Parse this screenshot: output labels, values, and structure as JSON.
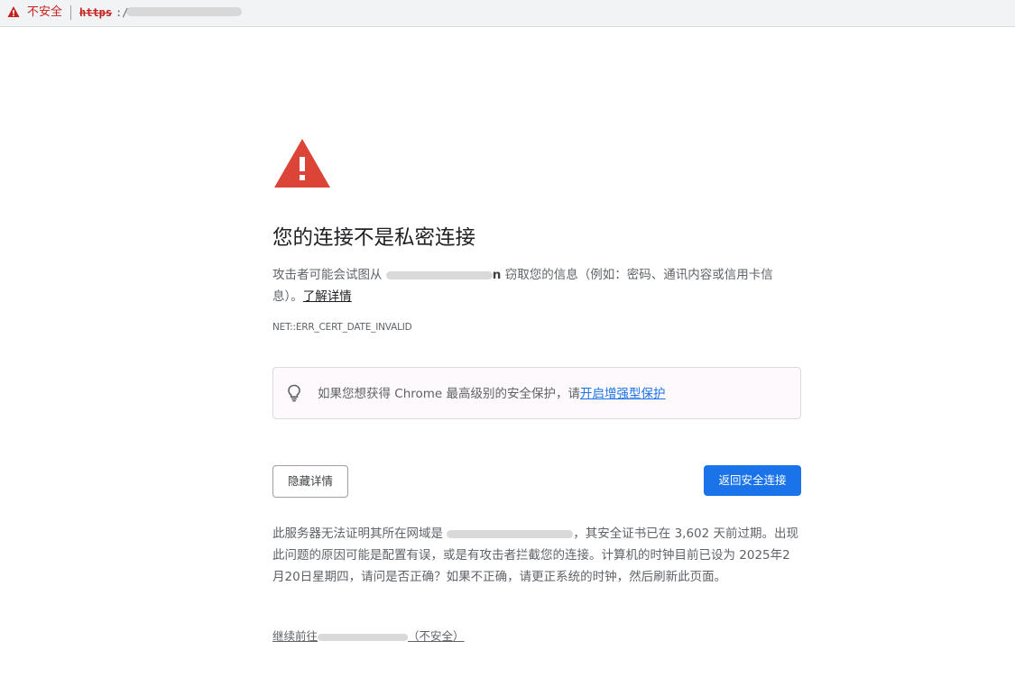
{
  "address_bar": {
    "security_label": "不安全",
    "url_scheme": "https",
    "url_rest": ":/"
  },
  "interstitial": {
    "title": "您的连接不是私密连接",
    "desc_before_host": "攻击者可能会试图从 ",
    "desc_host_fragment": "n",
    "desc_after_host": " 窃取您的信息（例如：密码、通讯内容或信用卡信息）。",
    "learn_more": "了解详情",
    "error_code": "NET::ERR_CERT_DATE_INVALID",
    "promo_text": "如果您想获得 Chrome 最高级别的安全保护，请",
    "promo_link": "开启增强型保护",
    "hide_details_button": "隐藏详情",
    "back_button": "返回安全连接",
    "details_before_host": "此服务器无法证明其所在网域是 ",
    "details_after_host": "，其安全证书已在 3,602 天前过期。出现此问题的原因可能是配置有误，或是有攻击者拦截您的连接。计算机的时钟目前已设为 2025年2月20日星期四，请问是否正确？如果不正确，请更正系统的时钟，然后刷新此页面。",
    "proceed_prefix": "继续前往",
    "proceed_suffix": "（不安全）"
  },
  "colors": {
    "warning_red": "#db4437",
    "link_blue": "#1a73e8",
    "button_blue": "#1a73e8",
    "text_gray": "#5f6368"
  },
  "icons": {
    "address_warning": "warning-triangle-icon",
    "page_warning": "warning-triangle-icon",
    "promo": "lightbulb-icon"
  }
}
